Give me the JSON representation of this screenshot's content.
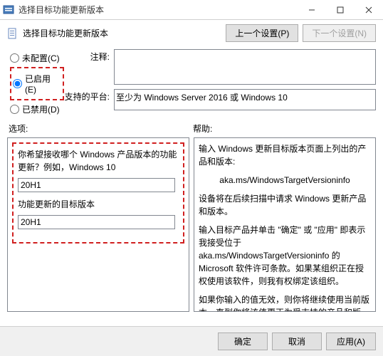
{
  "window": {
    "title": "选择目标功能更新版本"
  },
  "subheader": {
    "title": "选择目标功能更新版本",
    "prev_btn": "上一个设置(P)",
    "next_btn": "下一个设置(N)"
  },
  "radios": {
    "unconfigured": "未配置(C)",
    "enabled": "已启用(E)",
    "disabled": "已禁用(D)",
    "selected": "enabled"
  },
  "fields": {
    "comment_label": "注释:",
    "comment_value": "",
    "platform_label": "支持的平台:",
    "platform_value": "至少为 Windows Server 2016 或 Windows 10"
  },
  "sections": {
    "options_label": "选项:",
    "help_label": "帮助:"
  },
  "options": {
    "q1": "你希望接收哪个 Windows 产品版本的功能更新？例如，Windows 10",
    "val1": "20H1",
    "q2": "功能更新的目标版本",
    "val2": "20H1"
  },
  "help": {
    "p1": "输入 Windows 更新目标版本页面上列出的产品和版本:",
    "p2": "aka.ms/WindowsTargetVersioninfo",
    "p3": "设备将在后续扫描中请求 Windows 更新产品和版本。",
    "p4": "输入目标产品并单击 \"确定\" 或 \"应用\" 即表示我接受位于 aka.ms/WindowsTargetVersioninfo 的 Microsoft 软件许可条款。如果某组织正在授权使用该软件，则我有权绑定该组织。",
    "p5": "如果你输入的值无效，则你将继续使用当前版本，直到你将该值更正为受支持的产品和版本。"
  },
  "buttons": {
    "ok": "确定",
    "cancel": "取消",
    "apply": "应用(A)"
  }
}
